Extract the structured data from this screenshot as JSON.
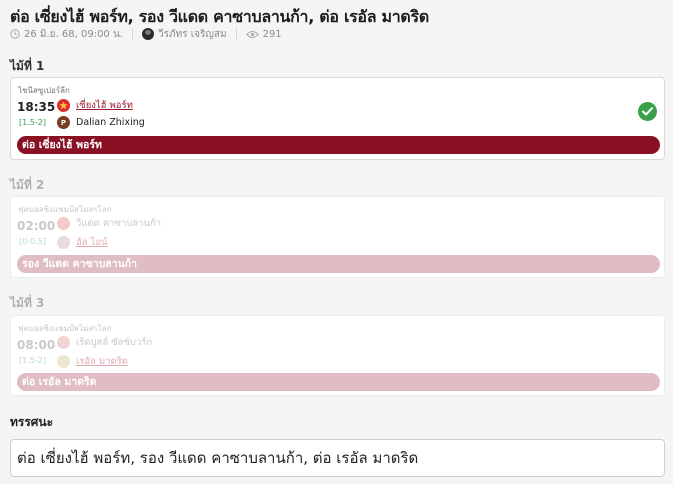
{
  "header": {
    "title": "ต่อ เซี่ยงไฮ้ พอร์ท, รอง วีแดด คาซาบลานก้า, ต่อ เรอัล มาดริด",
    "date": "26 มิ.ย. 68, 09:00 น.",
    "author": "วีรภัทร เจริญสม",
    "views": "291",
    "icons": {
      "date": "clock-icon",
      "author": "avatar",
      "views": "eye-icon"
    }
  },
  "picks": [
    {
      "label": "ไม้ที่ 1",
      "league": "ไชนีสซูเปอร์ลีก",
      "time": "18:35",
      "handicap": "[1.5-2]",
      "home": "เซี่ยงไฮ้ พอร์ท",
      "away": "Dalian Zhixing",
      "pick": "ต่อ เซี่ยงไฮ้ พอร์ท",
      "result_icon": "check-circle-icon"
    },
    {
      "label": "ไม้ที่ 2",
      "league": "ฟุตบอลชิงแชมป์สโมสรโลก",
      "time": "02:00",
      "handicap": "[0-0.5]",
      "home": "วีแดด คาซาบลานก้า",
      "away": "อัล ไอน์",
      "pick": "รอง วีแดด คาซาบลานก้า"
    },
    {
      "label": "ไม้ที่ 3",
      "league": "ฟุตบอลชิงแชมป์สโมสรโลก",
      "time": "08:00",
      "handicap": "[1.5-2]",
      "home": "เร้ดบูลล์ ซัลซ์บวร์ก",
      "away": "เรอัล มาดริด",
      "pick": "ต่อ เรอัล มาดริด"
    }
  ],
  "tip": {
    "label": "ทรรศนะ",
    "text": "ต่อ เซี่ยงไฮ้ พอร์ท, รอง วีแดด คาซาบลานก้า, ต่อ เรอัล มาดริด"
  },
  "colors": {
    "pick_bar": "#8a1123",
    "pick_bar_faded": "#dfbdc2",
    "win_check": "#3aa14a",
    "favorite_team": "#9b1b2e"
  }
}
